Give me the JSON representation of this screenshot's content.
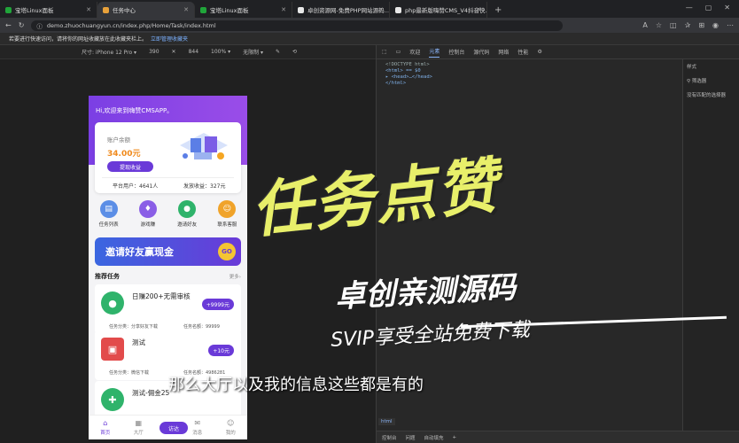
{
  "browser": {
    "tabs": [
      {
        "title": "宝塔Linux面板",
        "color": "#20a53a"
      },
      {
        "title": "任务中心",
        "color": "#e8a13a",
        "active": true
      },
      {
        "title": "宝塔Linux面板",
        "color": "#20a53a"
      },
      {
        "title": "卓创资源网-免费PHP网站源码…",
        "color": "#e8e8e8"
      },
      {
        "title": "php最新版嗨赞CMS_V4抖音快…",
        "color": "#e8e8e8"
      }
    ],
    "url": "demo.zhuochuangyun.cn/index.php/Home/Task/index.html",
    "infobar_text": "若要进行快速访问，请将你的网址收藏放在此收藏夹栏上。",
    "infobar_link": "立即管理收藏夹"
  },
  "device_toolbar": {
    "device": "尺寸: iPhone 12 Pro ▾",
    "width": "390",
    "height": "844",
    "zoom": "100% ▾",
    "throttle": "无限制 ▾"
  },
  "app": {
    "greeting": "Hi,欢迎来到嗨赞CMSAPP。",
    "balance_label": "账户余额",
    "balance_value": "34.00元",
    "withdraw_label": "提现收益",
    "users_stat": "平台用户：4641人",
    "income_stat": "发放收益：327元",
    "grid": [
      {
        "label": "任务列表",
        "color": "#5b8ee6",
        "icon": "📋"
      },
      {
        "label": "游戏赚",
        "color": "#8a5ee6",
        "icon": "♥"
      },
      {
        "label": "邀请好友",
        "color": "#2fb36b",
        "icon": "👤"
      },
      {
        "label": "联系客服",
        "color": "#f0a32a",
        "icon": "☺"
      }
    ],
    "banner_text": "邀请好友赢现金",
    "banner_go": "GO",
    "section_title": "推荐任务",
    "section_more": "更多›",
    "tasks": [
      {
        "name": "日赚200+无需审核",
        "price": "+9999元",
        "category": "任务分类：分享好友下载",
        "remain": "任务名额：99999",
        "color": "#2fb36b",
        "icon": "👤"
      },
      {
        "name": "测试",
        "price": "+10元",
        "category": "任务分类：微信下载",
        "remain": "任务名额：4986281",
        "color": "#e24b4b",
        "icon": "▣"
      },
      {
        "name": "测试-佣金25",
        "price": "",
        "category": "",
        "remain": "",
        "color": "#2fb36b",
        "icon": "🎮"
      }
    ],
    "tabnav": [
      {
        "label": "首页",
        "icon": "⌂",
        "active": true
      },
      {
        "label": "大厅",
        "icon": "▦",
        "active": false
      },
      {
        "label": "",
        "icon": "",
        "active": false
      },
      {
        "label": "消息",
        "icon": "✉",
        "active": false
      },
      {
        "label": "我的",
        "icon": "☺",
        "active": false
      }
    ],
    "center_button": "访达"
  },
  "devtools": {
    "tabs": [
      "欢迎",
      "元素",
      "控制台",
      "源代码",
      "网络",
      "性能"
    ],
    "dom_lines": [
      "<!DOCTYPE html>",
      "<html> == $0",
      "▸ <head>…</head>",
      "</html>"
    ],
    "styles_tab": "样式",
    "filter_placeholder": "筛选器",
    "no_match": "没有匹配的选择器",
    "breadcrumb": "html",
    "drawer_tabs": [
      "控制台",
      "问题",
      "自动填充"
    ]
  },
  "overlay": {
    "title": "任务点赞",
    "subtitle": "卓创亲测源码",
    "svip": "SVIP享受全站免费下载",
    "caption": "那么大厅以及我的信息这些都是有的"
  }
}
